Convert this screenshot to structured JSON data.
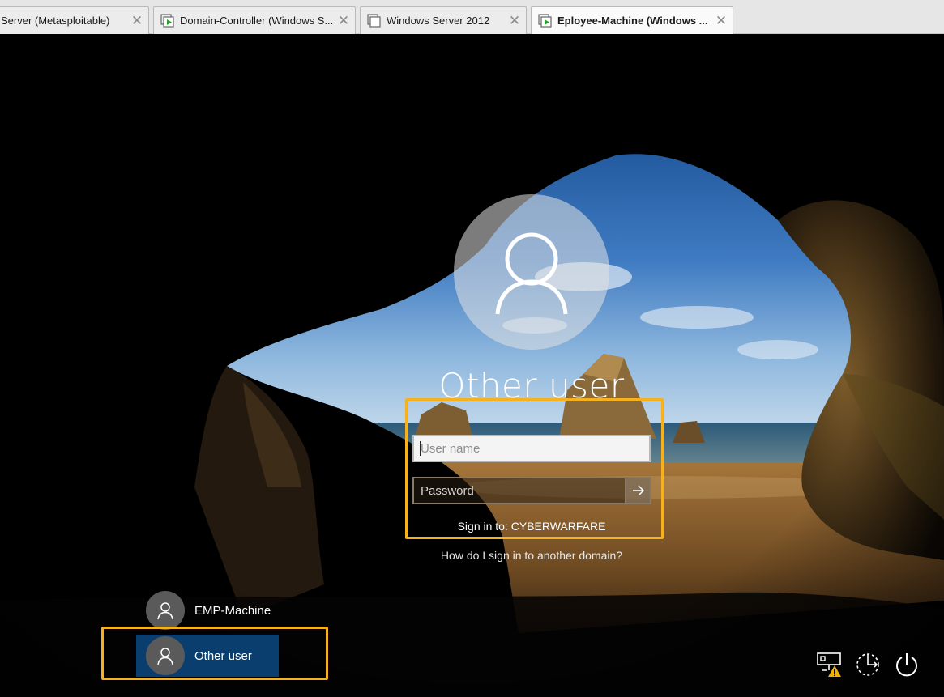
{
  "tabs": [
    {
      "label": "Server (Metasploitable)",
      "active": false
    },
    {
      "label": "Domain-Controller (Windows S...",
      "active": false
    },
    {
      "label": "Windows Server 2012",
      "active": false
    },
    {
      "label": "Eployee-Machine (Windows ...",
      "active": true
    }
  ],
  "login": {
    "title": "Other user",
    "username_placeholder": "User name",
    "password_placeholder": "Password",
    "sign_in_to": "Sign in to: CYBERWARFARE",
    "other_domain_link": "How do I sign in to another domain?"
  },
  "users": [
    {
      "label": "EMP-Machine",
      "selected": false
    },
    {
      "label": "Other user",
      "selected": true
    }
  ],
  "system_icons": [
    "network-warning-icon",
    "ease-of-access-icon",
    "power-icon"
  ],
  "colors": {
    "highlight": "#f6b11e",
    "selected_tile": "#0a3e6e",
    "vm_running_green": "#2aa12a"
  }
}
